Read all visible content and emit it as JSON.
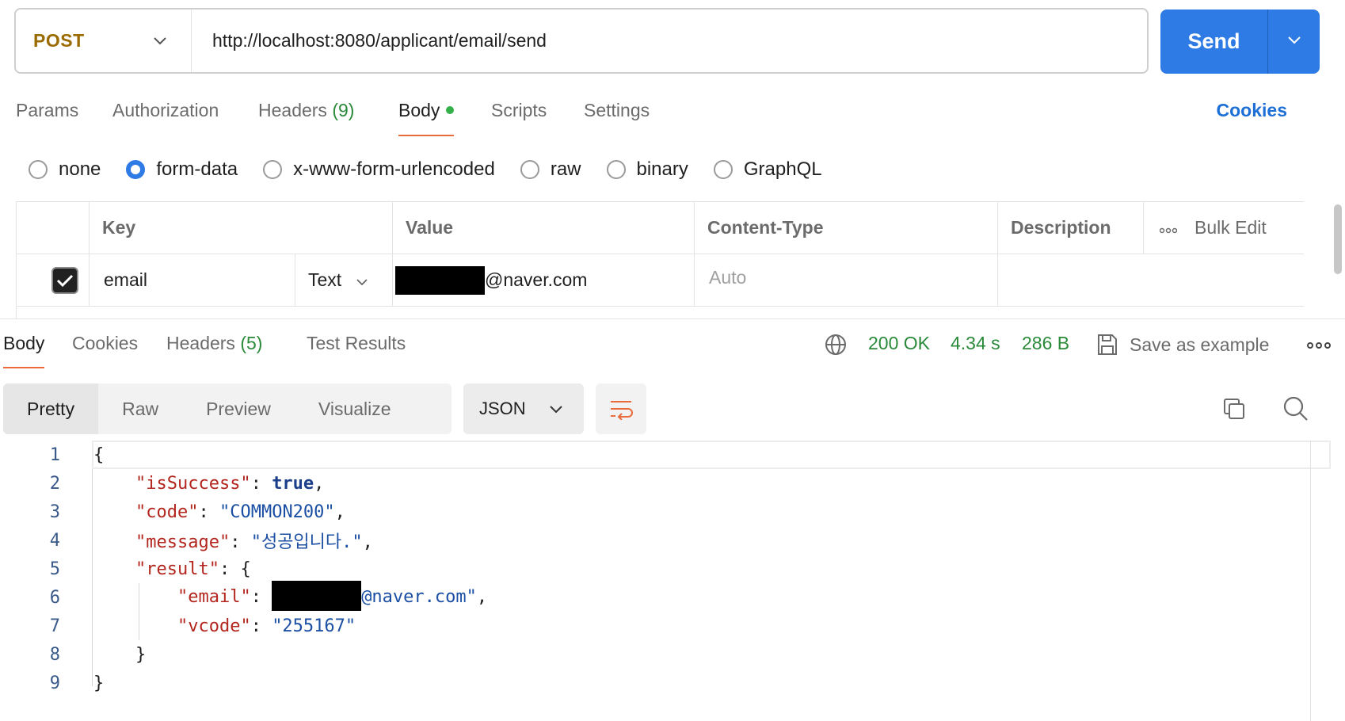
{
  "request": {
    "method": "POST",
    "url": "http://localhost:8080/applicant/email/send",
    "send_label": "Send"
  },
  "request_tabs": [
    {
      "label": "Params",
      "count": ""
    },
    {
      "label": "Authorization",
      "count": ""
    },
    {
      "label": "Headers",
      "count": "(9)"
    },
    {
      "label": "Body",
      "count": ""
    },
    {
      "label": "Scripts",
      "count": ""
    },
    {
      "label": "Settings",
      "count": ""
    }
  ],
  "active_request_tab": "Body",
  "cookies_link": "Cookies",
  "body_types": [
    "none",
    "form-data",
    "x-www-form-urlencoded",
    "raw",
    "binary",
    "GraphQL"
  ],
  "selected_body_type": "form-data",
  "form_table": {
    "headers": {
      "key": "Key",
      "value": "Value",
      "content_type": "Content-Type",
      "description": "Description",
      "bulk_edit": "Bulk Edit"
    },
    "rows": [
      {
        "checked": true,
        "key": "email",
        "type": "Text",
        "value_suffix": "@naver.com",
        "content_type_placeholder": "Auto",
        "description": ""
      }
    ]
  },
  "response_tabs": [
    {
      "label": "Body",
      "count": ""
    },
    {
      "label": "Cookies",
      "count": ""
    },
    {
      "label": "Headers",
      "count": "(5)"
    },
    {
      "label": "Test Results",
      "count": ""
    }
  ],
  "response_meta": {
    "status": "200 OK",
    "time": "4.34 s",
    "size": "286 B",
    "save_example": "Save as example"
  },
  "viewer_modes": [
    "Pretty",
    "Raw",
    "Preview",
    "Visualize"
  ],
  "active_viewer_mode": "Pretty",
  "format": "JSON",
  "code_lines": {
    "l1": "{",
    "l2_key": "\"isSuccess\"",
    "l2_val": "true",
    "l3_key": "\"code\"",
    "l3_val": "\"COMMON200\"",
    "l4_key": "\"message\"",
    "l4_val": "\"성공입니다.\"",
    "l5_key": "\"result\"",
    "l6_key": "\"email\"",
    "l6_val_suffix": "@naver.com\"",
    "l7_key": "\"vcode\"",
    "l7_val": "\"255167\"",
    "l8": "}",
    "l9": "}"
  },
  "line_numbers": [
    "1",
    "2",
    "3",
    "4",
    "5",
    "6",
    "7",
    "8",
    "9"
  ],
  "colors": {
    "accent": "#2f7be6",
    "method": "#9a6b00",
    "status_ok": "#2a8a3a",
    "active_tab_underline": "#e96a3a",
    "json_key": "#b3261e",
    "json_string": "#1b4fa3"
  },
  "icons": [
    "chevron-down-icon",
    "globe-icon",
    "save-icon",
    "more-icon",
    "wrap-lines-icon",
    "copy-icon",
    "search-icon",
    "check-icon"
  ]
}
